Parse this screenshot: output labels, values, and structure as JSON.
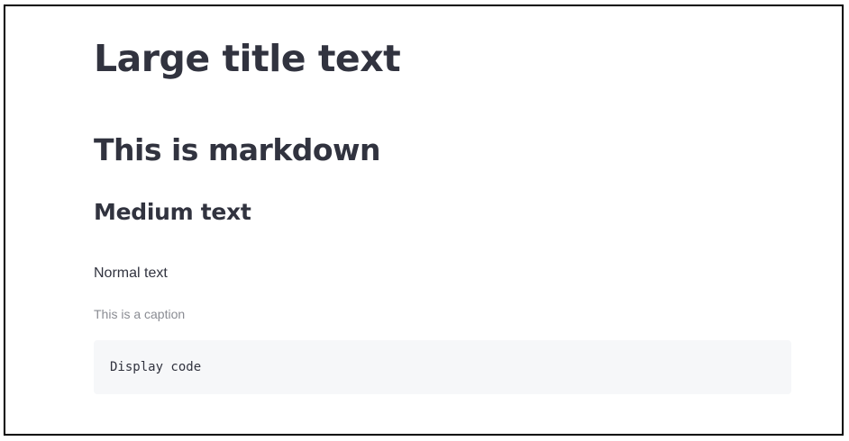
{
  "page": {
    "title": "Large title text",
    "header": "This is markdown",
    "subheader": "Medium text",
    "body_text": "Normal text",
    "caption": "This is a caption",
    "code": "Display code"
  },
  "colors": {
    "text": "#31333f",
    "caption": "#8a8c93",
    "code_background": "#f6f7f9",
    "border": "#000000"
  }
}
